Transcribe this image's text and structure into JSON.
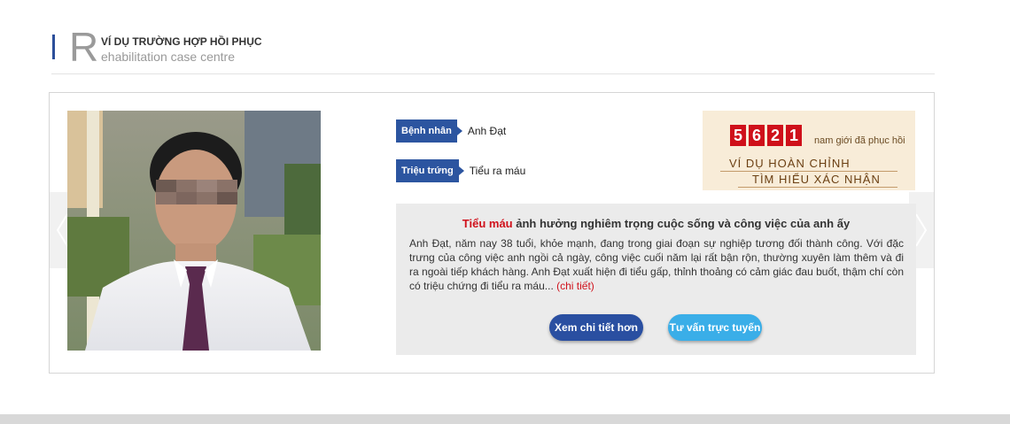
{
  "header": {
    "title": "VÍ DỤ TRƯỜNG HỢP HỒI PHỤC",
    "big_letter": "R",
    "subtitle": "ehabilitation case centre"
  },
  "patient": {
    "name_label": "Bệnh nhân",
    "name_value": "Anh Đạt",
    "symptom_label": "Triệu trứng",
    "symptom_value": "Tiểu ra máu"
  },
  "counter": {
    "digits": [
      "5",
      "6",
      "2",
      "1"
    ],
    "label": "nam giới đã phục hồi",
    "line1": "VÍ DỤ HOÀN CHỈNH",
    "line2": "TÌM HIỂU XÁC NHẬN"
  },
  "description": {
    "title_highlight": "Tiểu máu",
    "title_rest": " ảnh hưởng nghiêm trọng cuộc sống và công việc của anh ấy",
    "body": "Anh Đạt, năm nay 38 tuổi, khỏe mạnh, đang trong giai đoạn sự nghiệp tương đối thành công. Với đặc trưng của công việc anh ngồi cả ngày, công việc cuối năm lại rất bận rộn, thường xuyên làm thêm và đi ra ngoài tiếp khách hàng. Anh Đạt xuất hiện đi tiểu gấp, thỉnh thoảng có cảm giác đau buốt, thậm chí còn có triệu chứng đi tiểu ra máu...",
    "more_link": "(chi tiết)"
  },
  "buttons": {
    "detail": "Xem chi tiết hơn",
    "consult": "Tư vấn trực tuyến"
  },
  "colors": {
    "brand_blue": "#2c55a0",
    "accent_red": "#d0111b",
    "consult_blue": "#3aaee8"
  }
}
